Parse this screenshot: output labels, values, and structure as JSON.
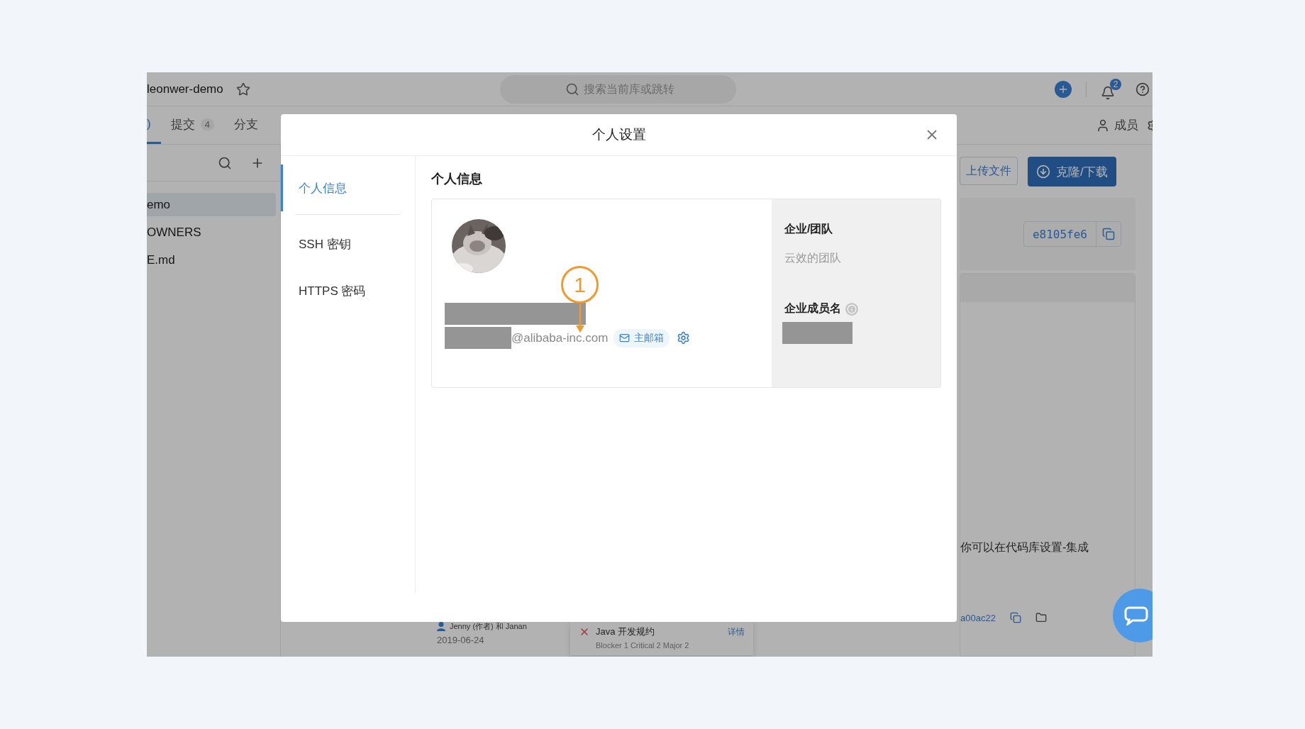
{
  "topbar": {
    "repo_name": "leonwer-demo",
    "search": {
      "placeholder": "搜索当前库或跳转"
    },
    "notification_count": "2"
  },
  "tabs": [
    {
      "label": ")",
      "selected": true
    },
    {
      "label": "提交",
      "count": "4",
      "selected": false
    },
    {
      "label": "分支",
      "selected": false
    }
  ],
  "members_label": "成员",
  "file_panel": {
    "items": [
      {
        "name": "emo",
        "selected": true
      },
      {
        "name": "OWNERS",
        "selected": false
      },
      {
        "name": "E.md",
        "selected": false
      }
    ]
  },
  "actions": {
    "upload": "上传文件",
    "clone": "克隆/下载"
  },
  "latest_commit": {
    "hash": "e8105fe6"
  },
  "hint_text": "你可以在代码库设置-集成",
  "commit": {
    "authors": "Jenny (作者) 和 Janan",
    "date": "2019-06-24",
    "hash": "a00ac22"
  },
  "check_popup": {
    "title": "Java 开发规约",
    "summary": "Blocker 1 Critical 2 Major 2",
    "link": "详情"
  },
  "dialog": {
    "title": "个人设置",
    "nav": [
      {
        "label": "个人信息",
        "selected": true
      },
      {
        "label": "SSH 密钥",
        "selected": false
      },
      {
        "label": "HTTPS 密码",
        "selected": false
      }
    ],
    "section_title": "个人信息",
    "profile": {
      "email_domain": "@alibaba-inc.com",
      "email_badge": "主邮箱"
    },
    "org": {
      "label": "企业/团队",
      "value": "云效的团队",
      "member_label": "企业成员名"
    }
  },
  "annotation": {
    "number": "1"
  }
}
